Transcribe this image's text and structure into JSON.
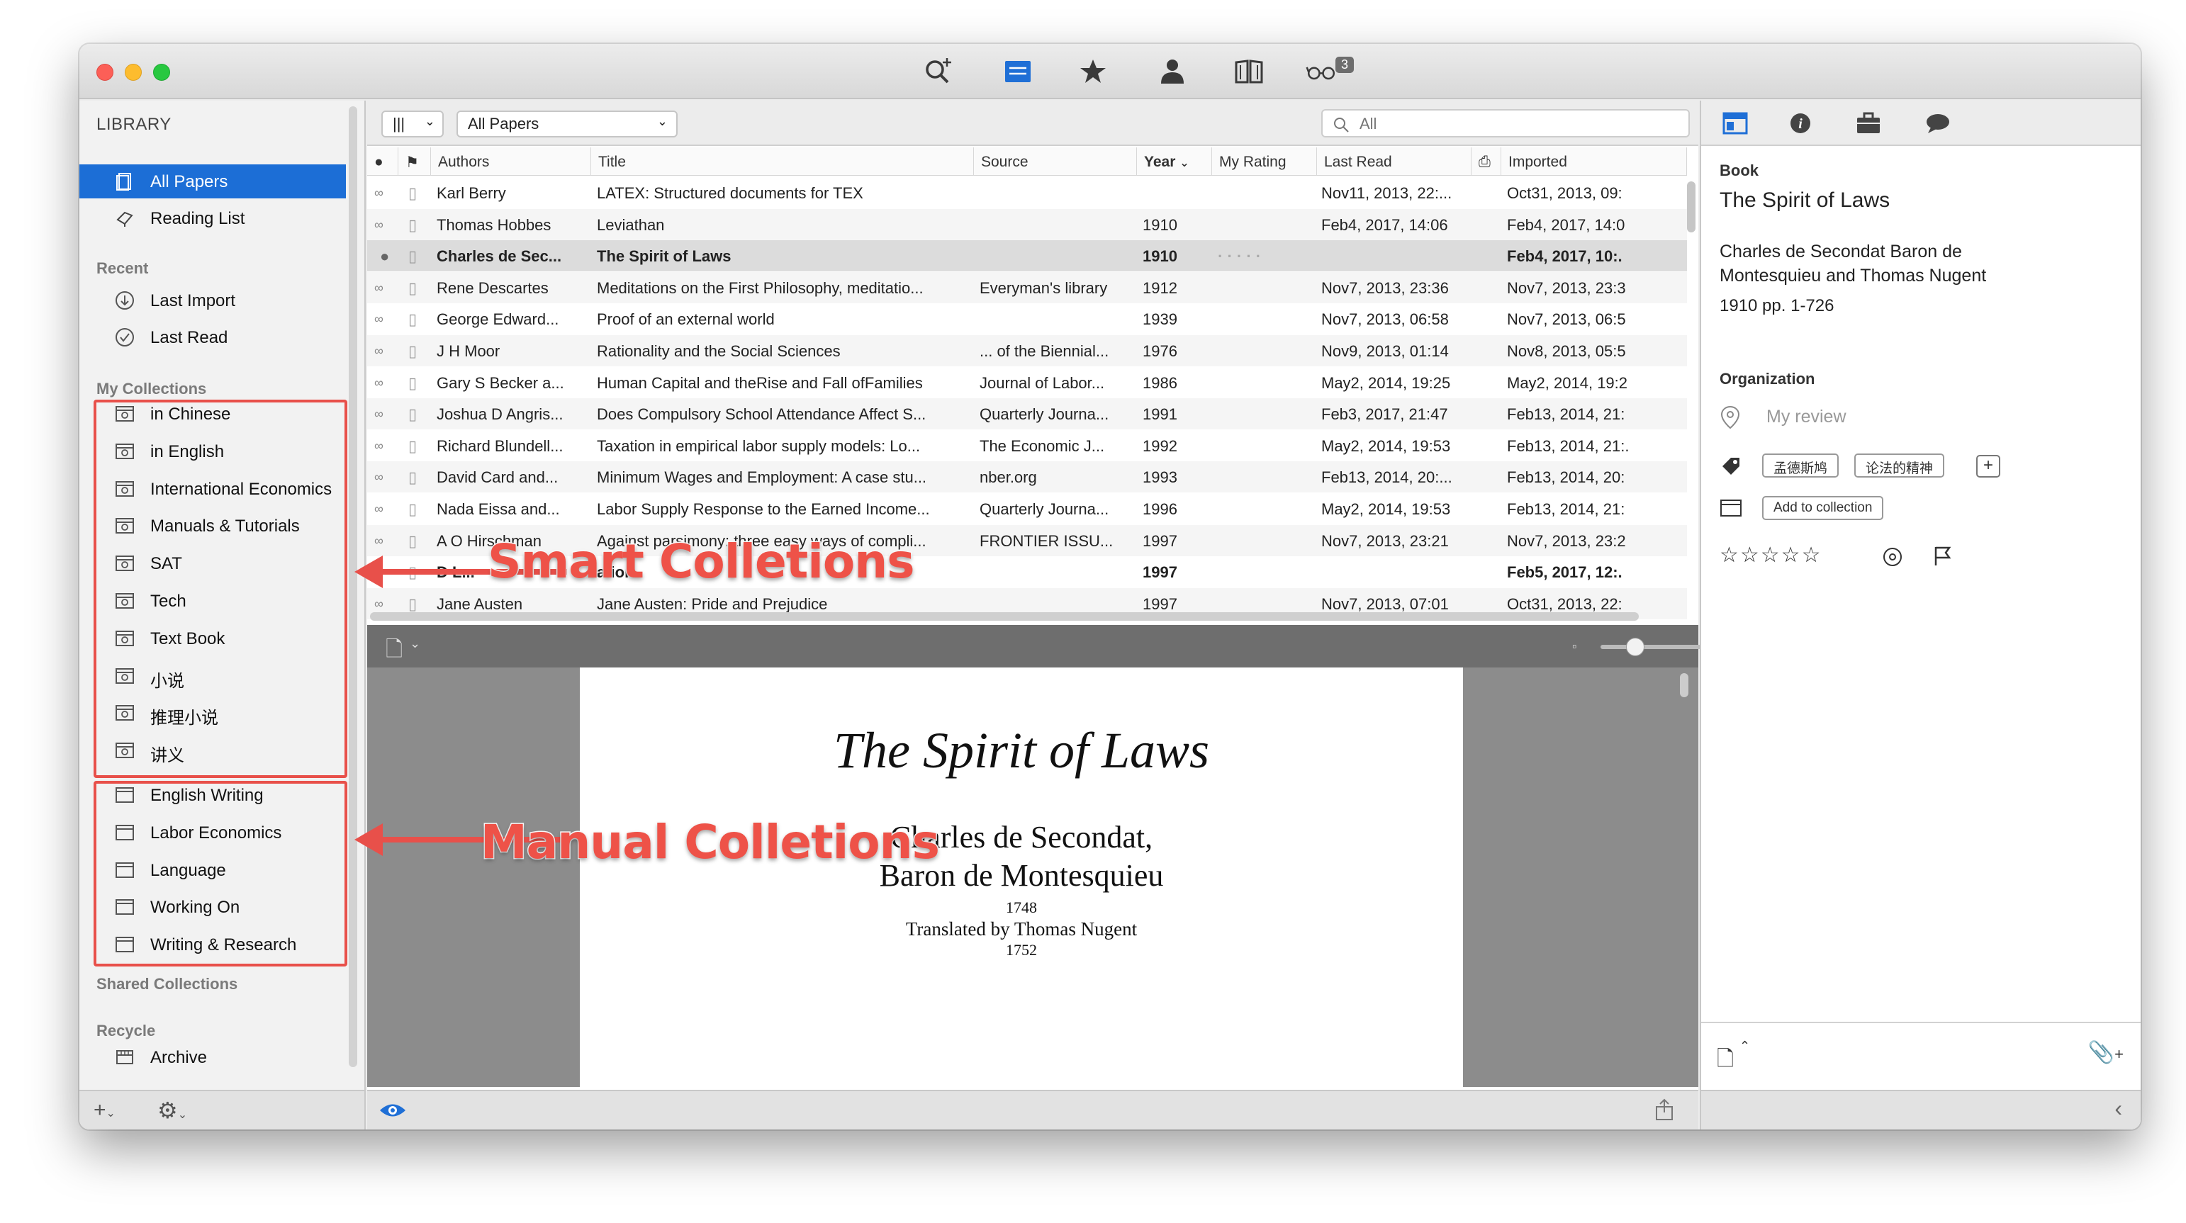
{
  "toolbar": {
    "icons": [
      "search-plus-icon",
      "collection-list-icon",
      "star-icon",
      "person-icon",
      "book-icon",
      "glasses-icon"
    ],
    "reading_badge": "3"
  },
  "sidebar": {
    "header": "LIBRARY",
    "top_items": [
      {
        "label": "All Papers",
        "icon": "papers-icon",
        "selected": true
      },
      {
        "label": "Reading List",
        "icon": "reading-list-icon",
        "selected": false
      }
    ],
    "recent_title": "Recent",
    "recent_items": [
      {
        "label": "Last Import",
        "icon": "import-icon"
      },
      {
        "label": "Last Read",
        "icon": "check-circle-icon"
      }
    ],
    "collections_title": "My Collections",
    "smart_collections": [
      "in Chinese",
      "in English",
      "International Economics",
      "Manuals & Tutorials",
      "SAT",
      "Tech",
      "Text Book",
      "小说",
      "推理小说",
      "讲义"
    ],
    "manual_collections": [
      "English Writing",
      "Labor Economics",
      "Language",
      "Working On",
      "Writing & Research"
    ],
    "shared_title": "Shared Collections",
    "recycle_title": "Recycle",
    "recycle_items": [
      "Archive"
    ]
  },
  "main": {
    "view_popup": "|||",
    "filter_popup": "All Papers",
    "search_placeholder": "All",
    "columns": {
      "authors": "Authors",
      "title": "Title",
      "source": "Source",
      "year": "Year",
      "rating": "My Rating",
      "last_read": "Last Read",
      "imported": "Imported"
    },
    "rows": [
      {
        "authors": "Karl Berry",
        "title": "LATEX: Structured documents for TEX",
        "source": "",
        "year": "",
        "rating": "",
        "last_read": "Nov11, 2013, 22:...",
        "imported": "Oct31, 2013, 09:"
      },
      {
        "authors": "Thomas Hobbes",
        "title": "Leviathan",
        "source": "",
        "year": "1910",
        "rating": "",
        "last_read": "Feb4, 2017, 14:06",
        "imported": "Feb4, 2017, 14:0"
      },
      {
        "authors": "Charles de Sec...",
        "title": "The Spirit of Laws",
        "source": "",
        "year": "1910",
        "rating": "· · · · ·",
        "last_read": "",
        "imported": "Feb4, 2017, 10:.",
        "selected": true
      },
      {
        "authors": "Rene Descartes",
        "title": "Meditations on the First Philosophy, meditatio...",
        "source": "Everyman's library",
        "year": "1912",
        "rating": "",
        "last_read": "Nov7, 2013, 23:36",
        "imported": "Nov7, 2013, 23:3"
      },
      {
        "authors": "George Edward...",
        "title": "Proof of an external world",
        "source": "",
        "year": "1939",
        "rating": "",
        "last_read": "Nov7, 2013, 06:58",
        "imported": "Nov7, 2013, 06:5"
      },
      {
        "authors": "J H Moor",
        "title": "Rationality and the Social Sciences",
        "source": "... of the Biennial...",
        "year": "1976",
        "rating": "",
        "last_read": "Nov9, 2013, 01:14",
        "imported": "Nov8, 2013, 05:5"
      },
      {
        "authors": "Gary S Becker a...",
        "title": "Human Capital and theRise and Fall ofFamilies",
        "source": "Journal of Labor...",
        "year": "1986",
        "rating": "",
        "last_read": "May2, 2014, 19:25",
        "imported": "May2, 2014, 19:2"
      },
      {
        "authors": "Joshua D Angris...",
        "title": "Does Compulsory School Attendance Affect S...",
        "source": "Quarterly Journa...",
        "year": "1991",
        "rating": "",
        "last_read": "Feb3, 2017, 21:47",
        "imported": "Feb13, 2014, 21:"
      },
      {
        "authors": "Richard Blundell...",
        "title": "Taxation in empirical labor supply models: Lo...",
        "source": "The Economic J...",
        "year": "1992",
        "rating": "",
        "last_read": "May2, 2014, 19:53",
        "imported": "Feb13, 2014, 21:."
      },
      {
        "authors": "David Card and...",
        "title": "Minimum Wages and Employment: A case stu...",
        "source": "nber.org",
        "year": "1993",
        "rating": "",
        "last_read": "Feb13, 2014, 20:...",
        "imported": "Feb13, 2014, 20:"
      },
      {
        "authors": "Nada Eissa and...",
        "title": "Labor Supply Response to the Earned Income...",
        "source": "Quarterly Journa...",
        "year": "1996",
        "rating": "",
        "last_read": "May2, 2014, 19:53",
        "imported": "Feb13, 2014, 21:"
      },
      {
        "authors": "A O Hirschman",
        "title": "Against parsimony: three easy ways of compli...",
        "source": "FRONTIER ISSU...",
        "year": "1997",
        "rating": "",
        "last_read": "Nov7, 2013, 23:21",
        "imported": "Nov7, 2013, 23:2"
      },
      {
        "authors": "D L...",
        "title": "ation",
        "source": "",
        "year": "1997",
        "rating": "",
        "last_read": "",
        "imported": "Feb5, 2017, 12:.",
        "bold": true
      },
      {
        "authors": "Jane Austen",
        "title": "Jane Austen: Pride and Prejudice",
        "source": "",
        "year": "1997",
        "rating": "",
        "last_read": "Nov7, 2013, 07:01",
        "imported": "Oct31, 2013, 22:"
      }
    ]
  },
  "preview": {
    "title": "The Spirit of Laws",
    "author_line1": "Charles de Secondat,",
    "author_line2": "Baron de Montesquieu",
    "year1": "1748",
    "translator": "Translated by Thomas Nugent",
    "year2": "1752"
  },
  "inspector": {
    "type_label": "Book",
    "title": "The Spirit of Laws",
    "authors": "Charles de Secondat Baron de Montesquieu and Thomas Nugent",
    "details": "1910 pp. 1-726",
    "organization_label": "Organization",
    "review_placeholder": "My review",
    "tags": [
      "孟德斯鸠",
      "论法的精神"
    ],
    "add_to_collection": "Add to collection"
  },
  "annotations": {
    "smart": "Smart Colletions",
    "manual": "Manual Colletions",
    "color": "#e8504a"
  }
}
